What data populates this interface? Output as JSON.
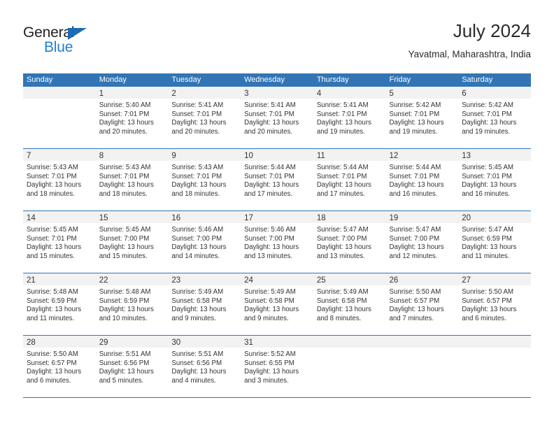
{
  "brand": {
    "name_part1": "General",
    "name_part2": "Blue"
  },
  "header": {
    "title": "July 2024",
    "location": "Yavatmal, Maharashtra, India"
  },
  "colors": {
    "header_blue": "#3275b5",
    "daynum_band": "#f2f2f2",
    "logo_blue": "#1f7fd0",
    "text": "#333333"
  },
  "calendar": {
    "weekday_headers": [
      "Sunday",
      "Monday",
      "Tuesday",
      "Wednesday",
      "Thursday",
      "Friday",
      "Saturday"
    ],
    "weeks": [
      [
        {
          "day": "",
          "sunrise": "",
          "sunset": "",
          "daylight_1": "",
          "daylight_2": "",
          "empty": true
        },
        {
          "day": "1",
          "sunrise": "Sunrise: 5:40 AM",
          "sunset": "Sunset: 7:01 PM",
          "daylight_1": "Daylight: 13 hours",
          "daylight_2": "and 20 minutes."
        },
        {
          "day": "2",
          "sunrise": "Sunrise: 5:41 AM",
          "sunset": "Sunset: 7:01 PM",
          "daylight_1": "Daylight: 13 hours",
          "daylight_2": "and 20 minutes."
        },
        {
          "day": "3",
          "sunrise": "Sunrise: 5:41 AM",
          "sunset": "Sunset: 7:01 PM",
          "daylight_1": "Daylight: 13 hours",
          "daylight_2": "and 20 minutes."
        },
        {
          "day": "4",
          "sunrise": "Sunrise: 5:41 AM",
          "sunset": "Sunset: 7:01 PM",
          "daylight_1": "Daylight: 13 hours",
          "daylight_2": "and 19 minutes."
        },
        {
          "day": "5",
          "sunrise": "Sunrise: 5:42 AM",
          "sunset": "Sunset: 7:01 PM",
          "daylight_1": "Daylight: 13 hours",
          "daylight_2": "and 19 minutes."
        },
        {
          "day": "6",
          "sunrise": "Sunrise: 5:42 AM",
          "sunset": "Sunset: 7:01 PM",
          "daylight_1": "Daylight: 13 hours",
          "daylight_2": "and 19 minutes."
        }
      ],
      [
        {
          "day": "7",
          "sunrise": "Sunrise: 5:43 AM",
          "sunset": "Sunset: 7:01 PM",
          "daylight_1": "Daylight: 13 hours",
          "daylight_2": "and 18 minutes."
        },
        {
          "day": "8",
          "sunrise": "Sunrise: 5:43 AM",
          "sunset": "Sunset: 7:01 PM",
          "daylight_1": "Daylight: 13 hours",
          "daylight_2": "and 18 minutes."
        },
        {
          "day": "9",
          "sunrise": "Sunrise: 5:43 AM",
          "sunset": "Sunset: 7:01 PM",
          "daylight_1": "Daylight: 13 hours",
          "daylight_2": "and 18 minutes."
        },
        {
          "day": "10",
          "sunrise": "Sunrise: 5:44 AM",
          "sunset": "Sunset: 7:01 PM",
          "daylight_1": "Daylight: 13 hours",
          "daylight_2": "and 17 minutes."
        },
        {
          "day": "11",
          "sunrise": "Sunrise: 5:44 AM",
          "sunset": "Sunset: 7:01 PM",
          "daylight_1": "Daylight: 13 hours",
          "daylight_2": "and 17 minutes."
        },
        {
          "day": "12",
          "sunrise": "Sunrise: 5:44 AM",
          "sunset": "Sunset: 7:01 PM",
          "daylight_1": "Daylight: 13 hours",
          "daylight_2": "and 16 minutes."
        },
        {
          "day": "13",
          "sunrise": "Sunrise: 5:45 AM",
          "sunset": "Sunset: 7:01 PM",
          "daylight_1": "Daylight: 13 hours",
          "daylight_2": "and 16 minutes."
        }
      ],
      [
        {
          "day": "14",
          "sunrise": "Sunrise: 5:45 AM",
          "sunset": "Sunset: 7:01 PM",
          "daylight_1": "Daylight: 13 hours",
          "daylight_2": "and 15 minutes."
        },
        {
          "day": "15",
          "sunrise": "Sunrise: 5:45 AM",
          "sunset": "Sunset: 7:00 PM",
          "daylight_1": "Daylight: 13 hours",
          "daylight_2": "and 15 minutes."
        },
        {
          "day": "16",
          "sunrise": "Sunrise: 5:46 AM",
          "sunset": "Sunset: 7:00 PM",
          "daylight_1": "Daylight: 13 hours",
          "daylight_2": "and 14 minutes."
        },
        {
          "day": "17",
          "sunrise": "Sunrise: 5:46 AM",
          "sunset": "Sunset: 7:00 PM",
          "daylight_1": "Daylight: 13 hours",
          "daylight_2": "and 13 minutes."
        },
        {
          "day": "18",
          "sunrise": "Sunrise: 5:47 AM",
          "sunset": "Sunset: 7:00 PM",
          "daylight_1": "Daylight: 13 hours",
          "daylight_2": "and 13 minutes."
        },
        {
          "day": "19",
          "sunrise": "Sunrise: 5:47 AM",
          "sunset": "Sunset: 7:00 PM",
          "daylight_1": "Daylight: 13 hours",
          "daylight_2": "and 12 minutes."
        },
        {
          "day": "20",
          "sunrise": "Sunrise: 5:47 AM",
          "sunset": "Sunset: 6:59 PM",
          "daylight_1": "Daylight: 13 hours",
          "daylight_2": "and 11 minutes."
        }
      ],
      [
        {
          "day": "21",
          "sunrise": "Sunrise: 5:48 AM",
          "sunset": "Sunset: 6:59 PM",
          "daylight_1": "Daylight: 13 hours",
          "daylight_2": "and 11 minutes."
        },
        {
          "day": "22",
          "sunrise": "Sunrise: 5:48 AM",
          "sunset": "Sunset: 6:59 PM",
          "daylight_1": "Daylight: 13 hours",
          "daylight_2": "and 10 minutes."
        },
        {
          "day": "23",
          "sunrise": "Sunrise: 5:49 AM",
          "sunset": "Sunset: 6:58 PM",
          "daylight_1": "Daylight: 13 hours",
          "daylight_2": "and 9 minutes."
        },
        {
          "day": "24",
          "sunrise": "Sunrise: 5:49 AM",
          "sunset": "Sunset: 6:58 PM",
          "daylight_1": "Daylight: 13 hours",
          "daylight_2": "and 9 minutes."
        },
        {
          "day": "25",
          "sunrise": "Sunrise: 5:49 AM",
          "sunset": "Sunset: 6:58 PM",
          "daylight_1": "Daylight: 13 hours",
          "daylight_2": "and 8 minutes."
        },
        {
          "day": "26",
          "sunrise": "Sunrise: 5:50 AM",
          "sunset": "Sunset: 6:57 PM",
          "daylight_1": "Daylight: 13 hours",
          "daylight_2": "and 7 minutes."
        },
        {
          "day": "27",
          "sunrise": "Sunrise: 5:50 AM",
          "sunset": "Sunset: 6:57 PM",
          "daylight_1": "Daylight: 13 hours",
          "daylight_2": "and 6 minutes."
        }
      ],
      [
        {
          "day": "28",
          "sunrise": "Sunrise: 5:50 AM",
          "sunset": "Sunset: 6:57 PM",
          "daylight_1": "Daylight: 13 hours",
          "daylight_2": "and 6 minutes."
        },
        {
          "day": "29",
          "sunrise": "Sunrise: 5:51 AM",
          "sunset": "Sunset: 6:56 PM",
          "daylight_1": "Daylight: 13 hours",
          "daylight_2": "and 5 minutes."
        },
        {
          "day": "30",
          "sunrise": "Sunrise: 5:51 AM",
          "sunset": "Sunset: 6:56 PM",
          "daylight_1": "Daylight: 13 hours",
          "daylight_2": "and 4 minutes."
        },
        {
          "day": "31",
          "sunrise": "Sunrise: 5:52 AM",
          "sunset": "Sunset: 6:55 PM",
          "daylight_1": "Daylight: 13 hours",
          "daylight_2": "and 3 minutes."
        },
        {
          "day": "",
          "sunrise": "",
          "sunset": "",
          "daylight_1": "",
          "daylight_2": "",
          "empty": true
        },
        {
          "day": "",
          "sunrise": "",
          "sunset": "",
          "daylight_1": "",
          "daylight_2": "",
          "empty": true
        },
        {
          "day": "",
          "sunrise": "",
          "sunset": "",
          "daylight_1": "",
          "daylight_2": "",
          "empty": true
        }
      ]
    ]
  }
}
